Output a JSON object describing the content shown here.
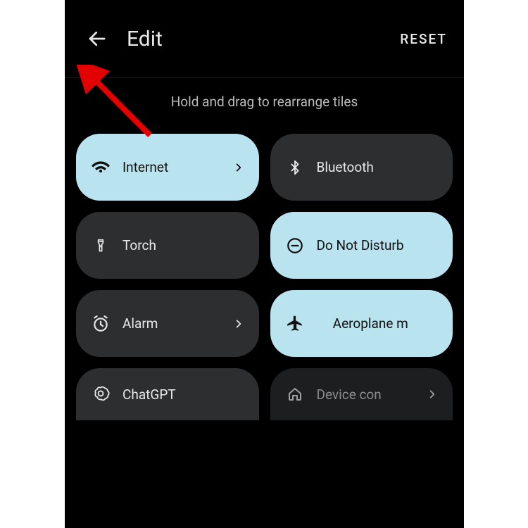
{
  "header": {
    "title": "Edit",
    "reset_label": "RESET"
  },
  "hint": "Hold and drag to rearrange tiles",
  "tiles": {
    "internet": {
      "label": "Internet"
    },
    "bluetooth": {
      "label": "Bluetooth"
    },
    "torch": {
      "label": "Torch"
    },
    "dnd": {
      "label": "Do Not Disturb"
    },
    "alarm": {
      "label": "Alarm"
    },
    "aeroplane": {
      "label": "Aeroplane m"
    },
    "chatgpt": {
      "label": "ChatGPT"
    },
    "device_ctrl": {
      "label": "Device con"
    }
  },
  "colors": {
    "accent": "#b9e4ef",
    "tile_dark": "#2c2e30"
  }
}
